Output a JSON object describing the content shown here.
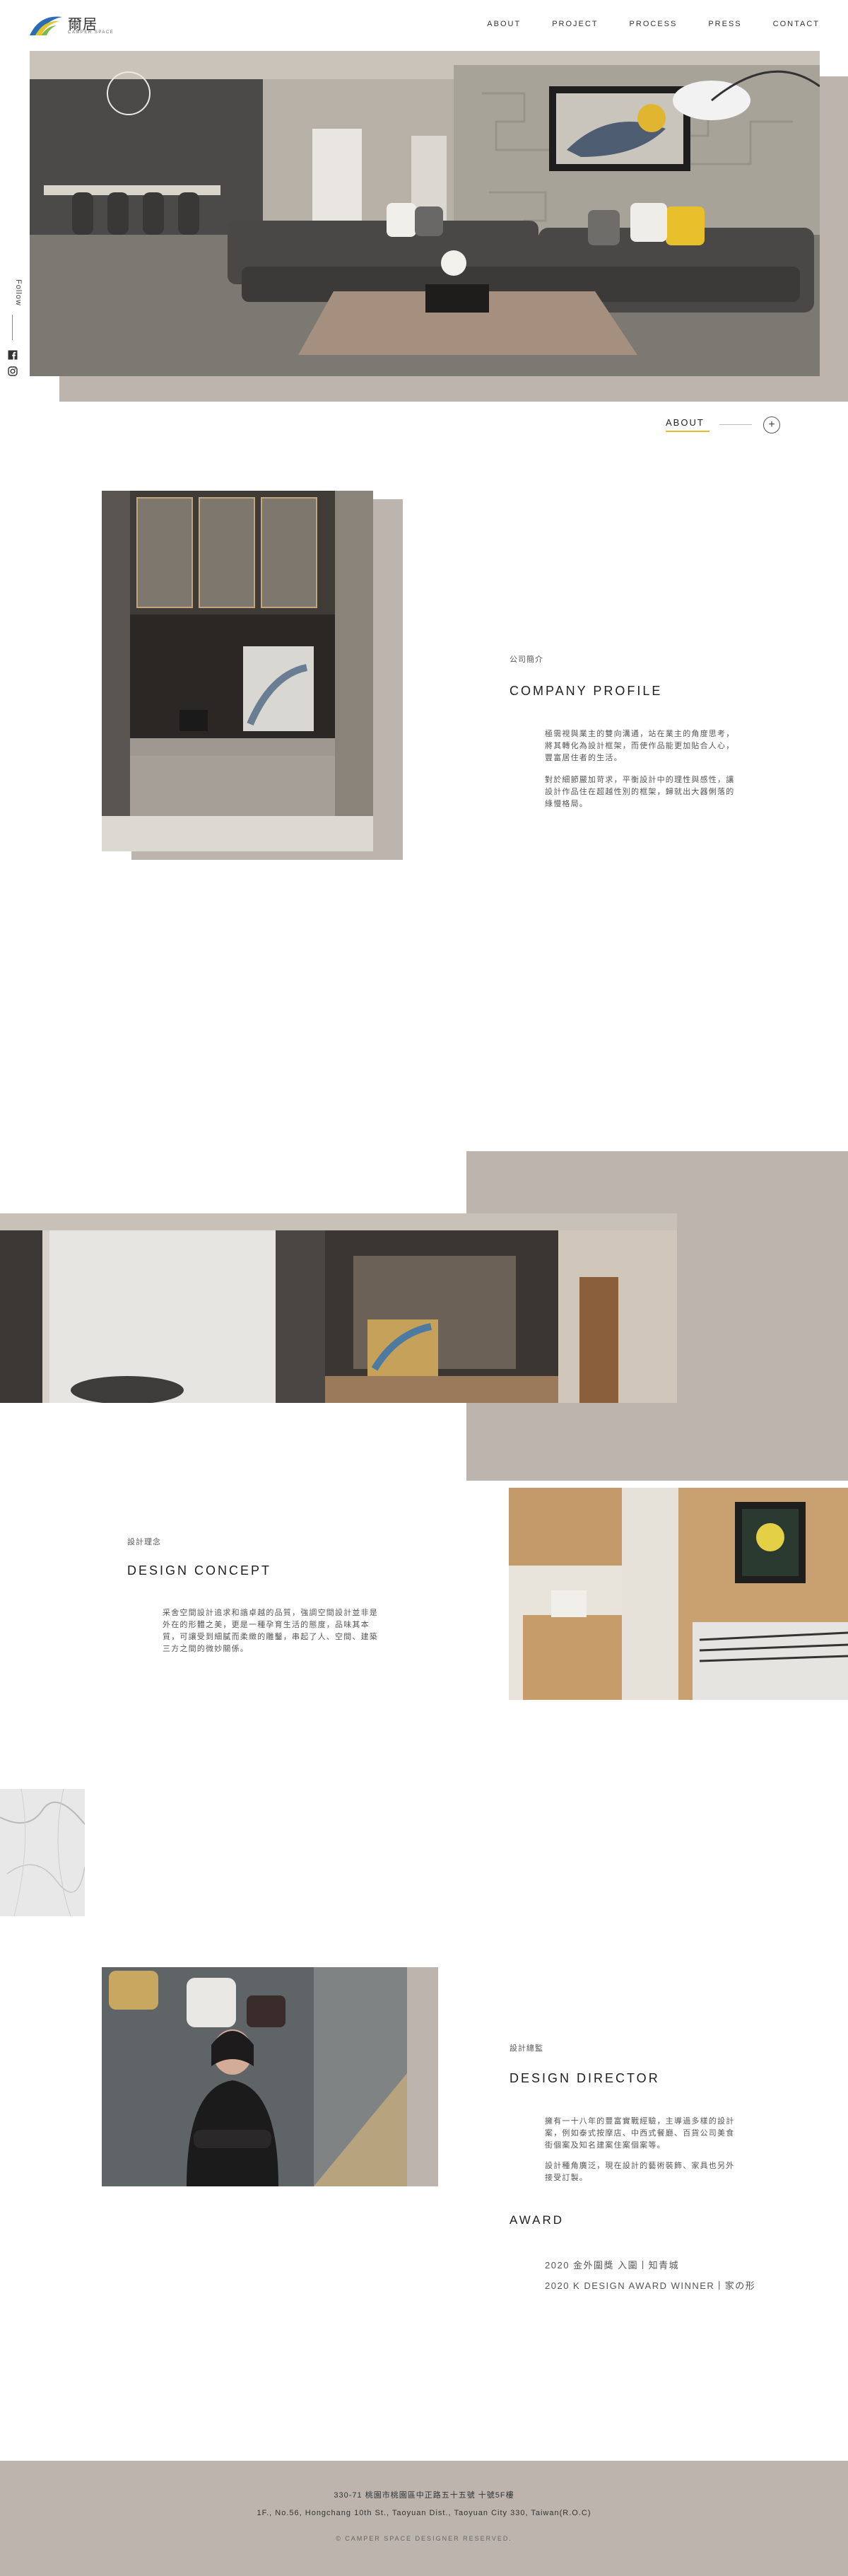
{
  "brand": {
    "name": "爾居",
    "tagline": "CAMPER SPACE"
  },
  "nav": [
    "ABOUT",
    "PROJECT",
    "PROCESS",
    "PRESS",
    "CONTACT"
  ],
  "social": {
    "follow_label": "Follow",
    "icons": [
      "facebook-icon",
      "instagram-icon"
    ]
  },
  "about_link": {
    "label": "ABOUT"
  },
  "profile": {
    "label": "公司簡介",
    "title": "COMPANY PROFILE",
    "paragraphs": [
      "極需視與業主的雙向溝通，站在業主的角度思考，將其轉化為設計框架，而使作品能更加貼合人心，豐富居住者的生活。",
      "對於細節嚴加苛求，平衡設計中的理性與感性，讓設計作品住在超越性別的框架，歸就出大器俐落的綠慢格局。"
    ]
  },
  "concept": {
    "label": "設計理念",
    "title": "DESIGN CONCEPT",
    "paragraphs": [
      "采舍空間設計追求和諧卓越的品質，強調空間設計並非是外在的形體之美，更是一種孕育生活的態度，品味其本質，可讓受到細膩而柔緻的雕鑿，串起了人、空間、建築三方之間的微妙關係。"
    ]
  },
  "director": {
    "label": "設計總監",
    "title": "DESIGN DIRECTOR",
    "paragraphs": [
      "擁有一十八年的豐富實戰經驗，主導過多樣的設計案，例如泰式按摩店、中西式餐廳、百貨公司美食街個案及知名建案住案個案等。",
      "設計種角廣泛，現在設計的藝術裝飾、家具也另外接受訂製。"
    ],
    "award_title": "AWARD",
    "awards": [
      "2020 金外圍獎 入圍丨知青城",
      "2020 K DESIGN AWARD WINNER丨家の形"
    ]
  },
  "footer": {
    "address_zh": "330-71 桃園市桃園區中正路五十五號 十號5F樓",
    "address_en": "1F., No.56, Hongchang 10th St., Taoyuan Dist., Taoyuan City 330, Taiwan(R.O.C)",
    "copyright": "© CAMPER SPACE DESIGNER RESERVED."
  },
  "colors": {
    "accent": "#e5bb30",
    "panel": "#bdb5ad"
  }
}
